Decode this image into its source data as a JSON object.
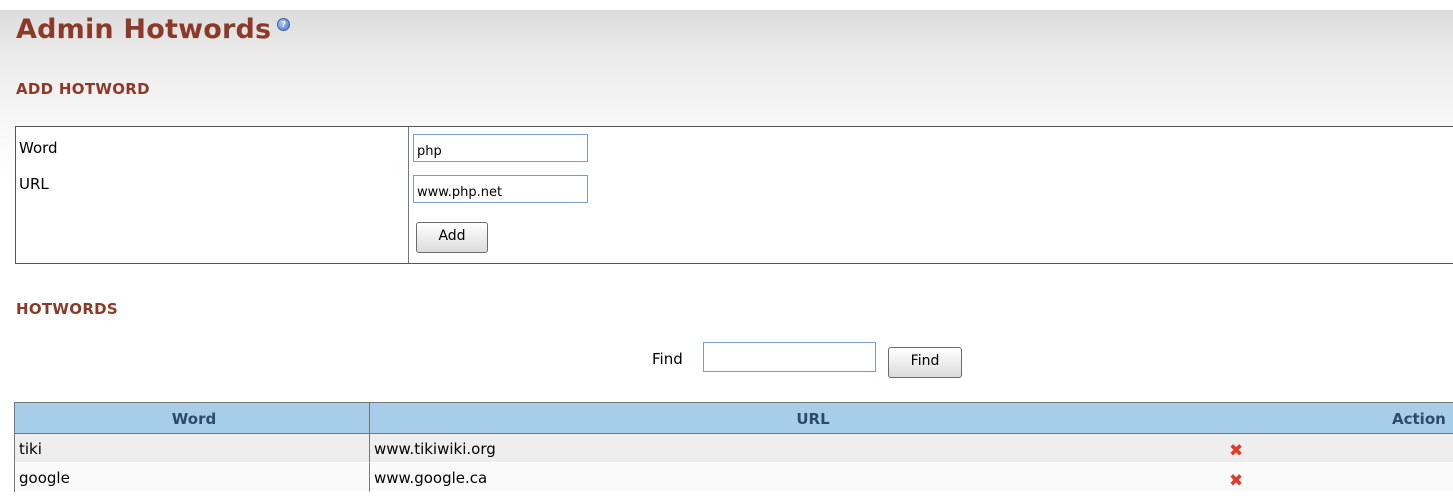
{
  "page": {
    "title": "Admin Hotwords",
    "help_icon": "help-icon"
  },
  "add_section": {
    "heading": "ADD HOTWORD",
    "word_label": "Word",
    "url_label": "URL",
    "word_value": "php",
    "url_value": "www.php.net",
    "add_button": "Add"
  },
  "list_section": {
    "heading": "HOTWORDS",
    "find_label": "Find",
    "find_value": "",
    "find_button": "Find"
  },
  "table": {
    "columns": [
      "Word",
      "URL",
      "Action"
    ],
    "rows": [
      {
        "word": "tiki",
        "url": "www.tikiwiki.org",
        "action_icon": "remove-icon"
      },
      {
        "word": "google",
        "url": "www.google.ca",
        "action_icon": "remove-icon"
      }
    ]
  },
  "colors": {
    "heading": "#8b3a2a",
    "table_header_bg": "#a6cde9",
    "remove_icon": "#e03a2a"
  }
}
